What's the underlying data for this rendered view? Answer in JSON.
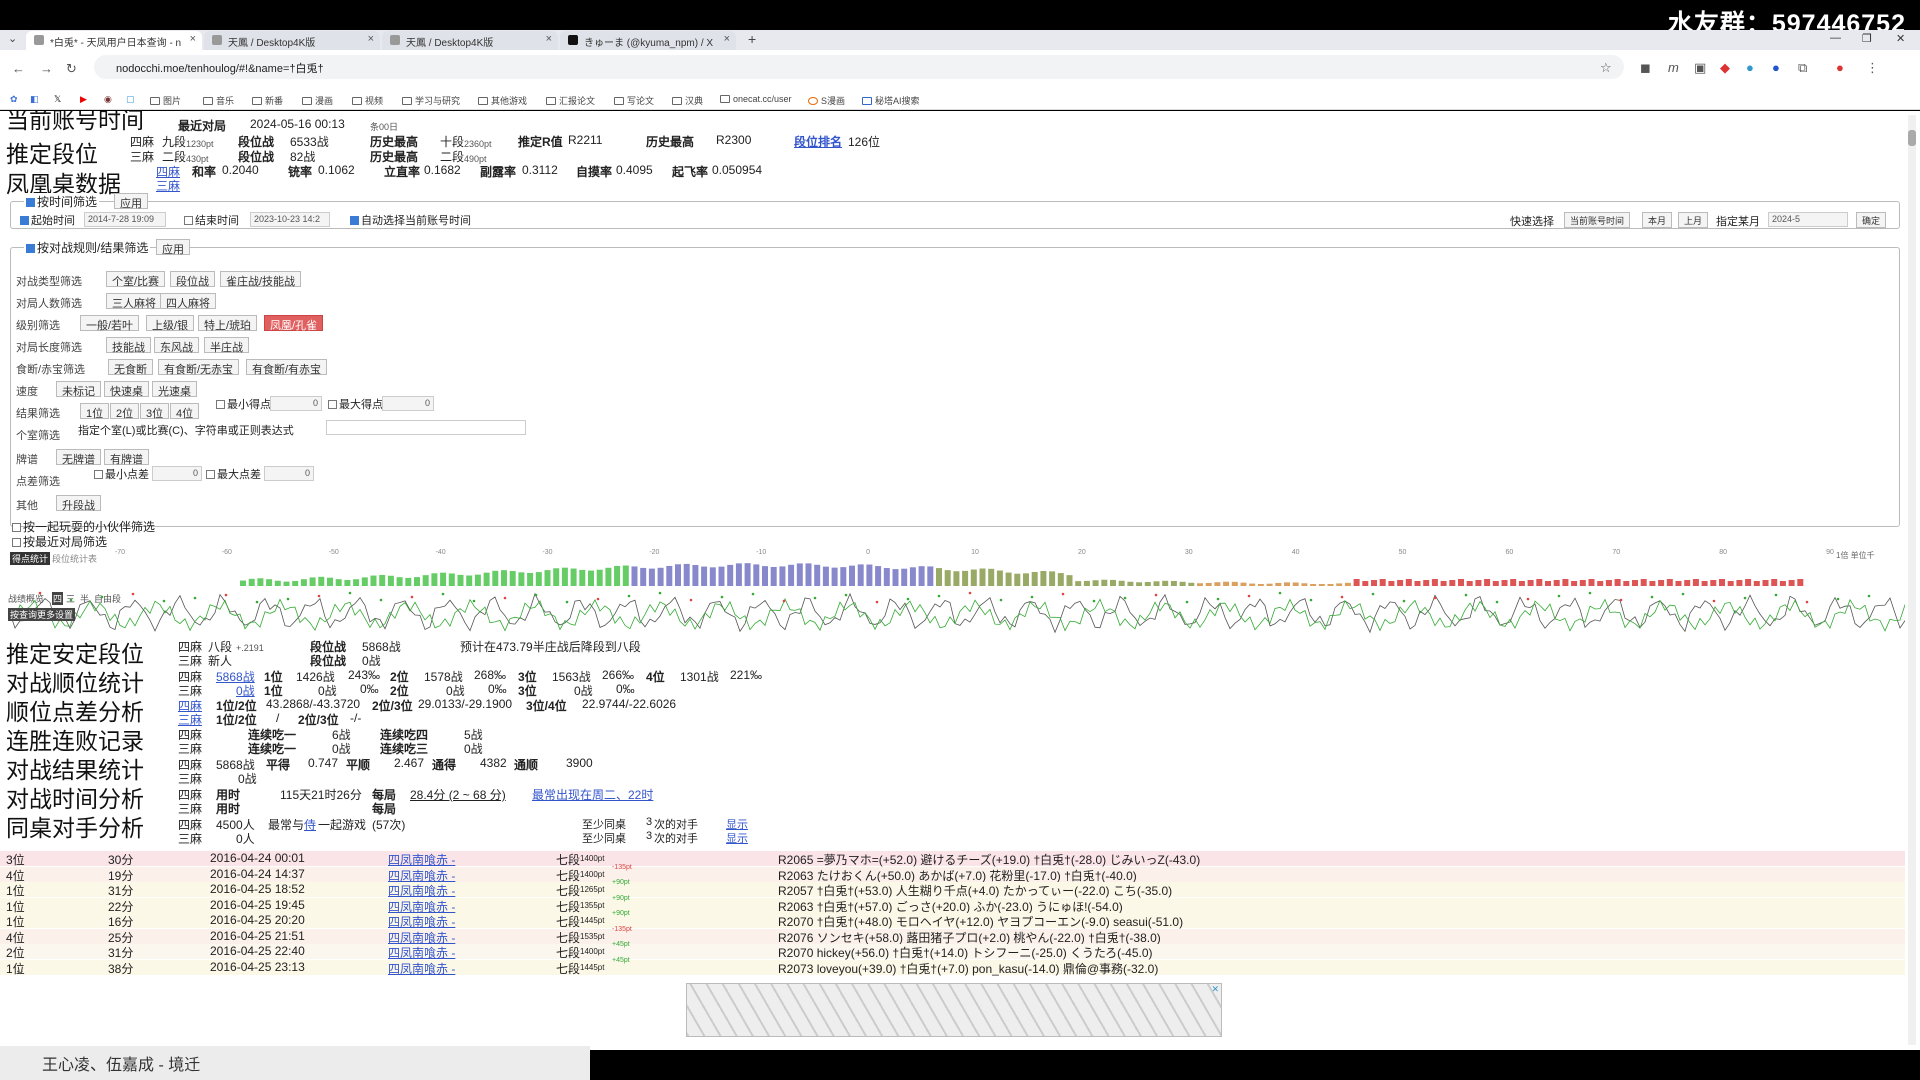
{
  "watermark": "水友群：597446752",
  "tabs": [
    {
      "title": "*白兎* - 天凤用户日本查询 - n"
    },
    {
      "title": "天鳳 / Desktop4K版"
    },
    {
      "title": "天鳳 / Desktop4K版"
    },
    {
      "title": "きゅーま (@kyuma_npm) / X"
    }
  ],
  "address": {
    "url": "nodocchi.moe/tenhoulog/#!&name=†白兎†"
  },
  "bookmarks": [
    "图片",
    "音乐",
    "新番",
    "漫画",
    "视频",
    "学习与研究",
    "其他游戏",
    "汇报论文",
    "写论文",
    "汉典",
    "onecat.cc/user",
    "S漫画",
    "秘塔AI搜索"
  ],
  "stats": {
    "heading_time": "当前账号时间",
    "heading_rank": "推定段位",
    "heading_phoenix": "凤凰桌数据",
    "recent_label": "最近对局",
    "recent_value": "2024-05-16 00:13",
    "recent_sub": "条00日",
    "four_label": "四麻",
    "three_label": "三麻",
    "four_rank": "九段",
    "four_pt": "1230pt",
    "three_rank": "二段",
    "three_pt": "430pt",
    "rankgames_label": "段位战",
    "rankgames_four": "6533战",
    "rankgames_three": "82战",
    "hist_label": "历史最高",
    "hist_four_rank": "十段",
    "hist_four_pt": "2360pt",
    "hist_three_rank": "二段",
    "hist_three_pt": "490pt",
    "rrating_label": "推定R值",
    "rrating_value": "R2211",
    "hist_r_label": "历史最高",
    "hist_r_value": "R2300",
    "ranking_label": "段位排名",
    "ranking_value": "126位",
    "phoenix_four": "四麻",
    "phoenix_three": "三麻",
    "win_label": "和率",
    "win_value": "0.2040",
    "deal_label": "铳率",
    "deal_value": "0.1062",
    "riichi_label": "立直率",
    "riichi_value": "0.1682",
    "call_label": "副露率",
    "call_value": "0.3112",
    "tsumo_label": "自摸率",
    "tsumo_value": "0.4095",
    "fly_label": "起飞率",
    "fly_value": "0.050954"
  },
  "time_filter": {
    "title": "按时间筛选",
    "apply": "应用",
    "start_label": "起始时间",
    "start_value": "2014-7-28 19:09",
    "end_label": "结束时间",
    "end_value": "2023-10-23 14:2",
    "auto_label": "自动选择当前账号时间",
    "quick_label": "快速选择",
    "quick_current": "当前账号时间",
    "quick_this_month": "本月",
    "quick_last_month": "上月",
    "month_label": "指定某月",
    "month_value": "2024-5",
    "month_confirm": "确定"
  },
  "rule_filter": {
    "title": "按对战规则/结果筛选",
    "apply": "应用",
    "rows": [
      {
        "label": "对战类型筛选",
        "buttons": [
          "个室/比赛",
          "段位战",
          "雀庄战/技能战"
        ]
      },
      {
        "label": "对局人数筛选",
        "buttons": [
          "三人麻将",
          "四人麻将"
        ]
      },
      {
        "label": "级别筛选",
        "buttons": [
          "一般/若叶",
          "上级/银",
          "特上/琥珀",
          "凤凰/孔雀"
        ]
      },
      {
        "label": "对局长度筛选",
        "buttons": [
          "技能战",
          "东风战",
          "半庄战"
        ]
      },
      {
        "label": "食断/赤宝筛选",
        "buttons": [
          "无食断",
          "有食断/无赤宝",
          "有食断/有赤宝"
        ]
      },
      {
        "label": "速度",
        "buttons": [
          "未标记",
          "快速桌",
          "光速桌"
        ]
      },
      {
        "label": "结果筛选",
        "buttons": [
          "1位",
          "2位",
          "3位",
          "4位"
        ]
      },
      {
        "label": "个室筛选",
        "buttons": []
      },
      {
        "label": "牌谱",
        "buttons": [
          "无牌谱",
          "有牌谱"
        ]
      },
      {
        "label": "点差筛选",
        "buttons": []
      },
      {
        "label": "其他",
        "buttons": [
          "升段战"
        ]
      }
    ],
    "min_score_label": "最小得点",
    "max_score_label": "最大得点",
    "min_score_value": "0",
    "max_score_value": "0",
    "room_hint": "指定个室(L)或比赛(C)、字符串或正则表达式",
    "min_diff_label": "最小点差",
    "max_diff_label": "最大点差",
    "min_diff_value": "0",
    "max_diff_value": "0"
  },
  "extra_filters": [
    "按一起玩耍的小伙伴筛选",
    "按最近对局筛选"
  ],
  "histogram": {
    "tab_score": "得点统计",
    "tab_rank": "段位统计表",
    "axis_ticks": [
      "-70",
      "-60",
      "-50",
      "-40",
      "-30",
      "-20",
      "-10",
      "0",
      "10",
      "20",
      "30",
      "40",
      "50",
      "60",
      "70",
      "80",
      "90"
    ],
    "right_label": "1倍 单位千"
  },
  "lineplot": {
    "tab_label": "战绩概览",
    "tabs": [
      "四",
      "三",
      "半",
      "自由段"
    ],
    "switch_label": "按查询更多设置"
  },
  "section_headings": [
    "推定安定段位",
    "对战顺位统计",
    "顺位点差分析",
    "连胜连败记录",
    "对战结果统计",
    "对战时间分析",
    "同桌对手分析"
  ],
  "stable": {
    "four": "四麻",
    "four_rank": "八段",
    "four_r": "+.2191",
    "three": "三麻",
    "three_rank": "新人",
    "games_label": "段位战",
    "four_games": "5868战",
    "three_games": "0战",
    "note": "预计在473.79半庄战后降段到八段"
  },
  "placement": {
    "four_total": "5868战",
    "three_total": "0战",
    "p1_label": "1位",
    "p2_label": "2位",
    "p3_label": "3位",
    "p4_label": "4位",
    "four": [
      "1426战",
      "243‰",
      "1578战",
      "268‰",
      "1563战",
      "266‰",
      "1301战",
      "221‰"
    ],
    "three": [
      "0战",
      "0‰",
      "0战",
      "0‰",
      "0战",
      "0‰"
    ]
  },
  "diff": {
    "l12": "1位/2位",
    "l23": "2位/3位",
    "l34": "3位/4位",
    "v12": "43.2868/-43.3720",
    "v23": "29.0133/-29.1900",
    "v34": "22.9744/-22.6026",
    "three_v12": "/",
    "three_v23": "-/-"
  },
  "streak": {
    "l1": "连续吃一",
    "l4": "连续吃四",
    "l3": "连续吃三",
    "v1": "6战",
    "v4": "5战",
    "v3": "0战"
  },
  "results": {
    "games": "5868战",
    "avg_label": "平得",
    "avg_value": "0.747",
    "rank_label": "平顺",
    "rank_value": "2.467",
    "total_label": "通得",
    "total_value": "4382",
    "total_rank_label": "通顺",
    "total_rank_value": "3900",
    "three_games": "0战"
  },
  "timing": {
    "time_label": "用时",
    "time_value": "115天21时26分",
    "per_label": "每局",
    "per_value": "28.4分 (2 ~ 68 分)",
    "weekday": "最常出现在周二、22时"
  },
  "opponents": {
    "four_count": "4500人",
    "three_count": "0人",
    "most_label": "最常与",
    "most_name": "侍",
    "most_suffix": "一起游戏",
    "most_games": "(57次)",
    "min_label": "至少同桌",
    "min_value": "3",
    "min_suffix": "次的对手",
    "show": "显示"
  },
  "games": [
    {
      "place": "3位",
      "dur": "30分",
      "date": "2016-04-24 00:01",
      "room": "四凤南喰赤 -",
      "rank": "七段",
      "pt": "1400pt",
      "delta": "",
      "record": "R2065  =夢乃マホ=(+52.0) 避けるチーズ(+19.0) †白兎†(-28.0) じみいっZ(-43.0)",
      "bg": "#fbe4e8"
    },
    {
      "place": "4位",
      "dur": "19分",
      "date": "2016-04-24 14:37",
      "room": "四凤南喰赤 -",
      "rank": "七段",
      "pt": "1400pt",
      "delta": "-135pt",
      "record": "R2063  たけおくん(+50.0) あかば(+7.0) 花粉里(-17.0) †白兎†(-40.0)",
      "bg": "#fbf1ea"
    },
    {
      "place": "1位",
      "dur": "31分",
      "date": "2016-04-25 18:52",
      "room": "四凤南喰赤 -",
      "rank": "七段",
      "pt": "1265pt",
      "delta": "+90pt",
      "record": "R2057  †白兎†(+53.0) 人生糊り千点(+4.0) たかってぃー(-22.0) こち(-35.0)",
      "bg": "#fcf8e8"
    },
    {
      "place": "1位",
      "dur": "22分",
      "date": "2016-04-25 19:45",
      "room": "四凤南喰赤 -",
      "rank": "七段",
      "pt": "1355pt",
      "delta": "+90pt",
      "record": "R2063  †白兎†(+57.0) ごっさ(+20.0) ふか(-23.0) うにゅほ!(-54.0)",
      "bg": "#fcf8e8"
    },
    {
      "place": "1位",
      "dur": "16分",
      "date": "2016-04-25 20:20",
      "room": "四凤南喰赤 -",
      "rank": "七段",
      "pt": "1445pt",
      "delta": "+90pt",
      "record": "R2070  †白兎†(+48.0) モロヘイヤ(+12.0) ヤヨプコーエン(-9.0) seasui(-51.0)",
      "bg": "#fcf8e8"
    },
    {
      "place": "4位",
      "dur": "25分",
      "date": "2016-04-25 21:51",
      "room": "四凤南喰赤 -",
      "rank": "七段",
      "pt": "1535pt",
      "delta": "-135pt",
      "record": "R2076  ソンセキ(+58.0) 蕗田猪子プロ(+2.0) 桃やん(-22.0) †白兎†(-38.0)",
      "bg": "#fbf1ea"
    },
    {
      "place": "2位",
      "dur": "31分",
      "date": "2016-04-25 22:40",
      "room": "四凤南喰赤 -",
      "rank": "七段",
      "pt": "1400pt",
      "delta": "+45pt",
      "record": "R2070  hickey(+56.0) †白兎†(+14.0) トシフーニ(-25.0) くうたろ(-45.0)",
      "bg": "#fbf6ee"
    },
    {
      "place": "1位",
      "dur": "38分",
      "date": "2016-04-25 23:13",
      "room": "四凤南喰赤 -",
      "rank": "七段",
      "pt": "1445pt",
      "delta": "+45pt",
      "record": "R2073  loveyou(+39.0) †白兎†(+7.0) pon_kasu(-14.0) 鼎倫@事務(-32.0)",
      "bg": "#fcf8e8"
    }
  ],
  "bottom_text": "王心凌、伍嘉成 - 境迁"
}
